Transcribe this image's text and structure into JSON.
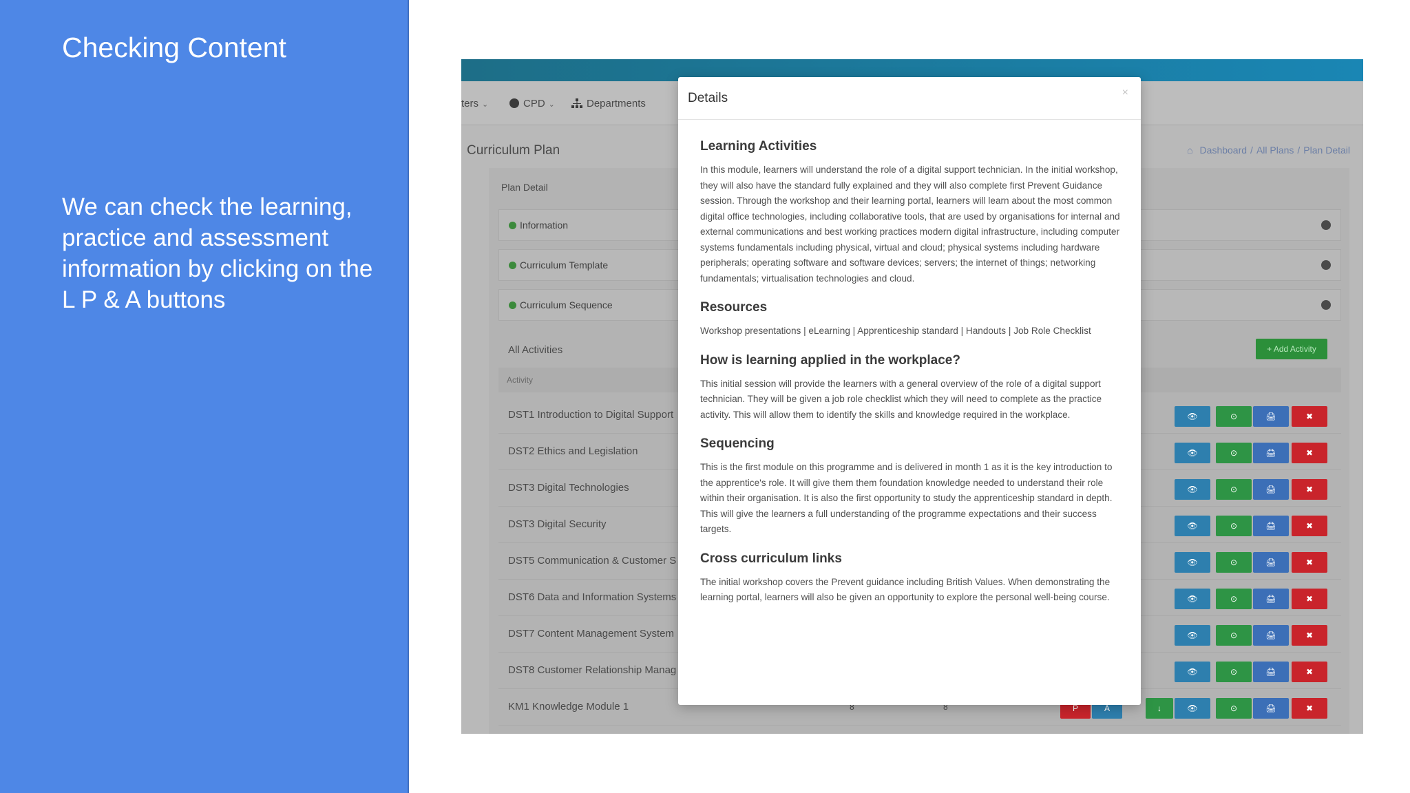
{
  "slide": {
    "title": "Checking Content",
    "body": "We can check the learning, practice and assessment information by clicking on the L P & A buttons"
  },
  "app": {
    "menu": [
      {
        "label": "ters",
        "icon": "none"
      },
      {
        "label": "CPD",
        "icon": "circle-icon"
      },
      {
        "label": "Departments",
        "icon": "sitemap-icon"
      }
    ],
    "page_heading": "Curriculum Plan",
    "breadcrumb": [
      "Dashboard",
      "All Plans",
      "Plan Detail"
    ],
    "card_title": "Plan Detail",
    "accordion": [
      "Information",
      "Curriculum Template",
      "Curriculum Sequence"
    ],
    "all_activities": "All Activities",
    "add_activity": "+ Add Activity",
    "table_header": "Activity",
    "activities": [
      "DST1 Introduction to Digital Support",
      "DST2 Ethics and Legislation",
      "DST3 Digital Technologies",
      "DST3 Digital Security",
      "DST5 Communication & Customer S",
      "DST6 Data and Information Systems",
      "DST7 Content Management System",
      "DST8 Customer Relationship Manag",
      "KM1 Knowledge Module 1"
    ],
    "last_row": {
      "col1": "8",
      "col2": "8",
      "p_label": "P",
      "a_label": "A",
      "dl_label": "↓"
    },
    "button_labels": {
      "view": "👁",
      "ok": "⊙",
      "print": "🖨",
      "del": "✖"
    }
  },
  "modal": {
    "title": "Details",
    "close": "×",
    "sections": [
      {
        "heading": "Learning Activities",
        "text": "In this module, learners will understand the role of a digital support technician. In the initial workshop, they will also have the standard fully explained and they will also complete first Prevent Guidance session. Through the workshop and their learning portal, learners will learn about the most common digital office technologies, including collaborative tools, that are used by organisations for internal and external communications and best working practices modern digital infrastructure, including computer systems fundamentals including physical, virtual and cloud; physical systems including hardware peripherals; operating software and software devices; servers; the internet of things; networking fundamentals; virtualisation technologies and cloud."
      },
      {
        "heading": "Resources",
        "text": "Workshop presentations | eLearning | Apprenticeship standard | Handouts | Job Role Checklist"
      },
      {
        "heading": "How is learning applied in the workplace?",
        "text": "This initial session will provide the learners with a general overview of the role of a digital support technician. They will be given a job role checklist which they will need to complete as the practice activity. This will allow them to identify the skills and knowledge required in the workplace."
      },
      {
        "heading": "Sequencing",
        "text": "This is the first module on this programme and is delivered in month 1 as it is the key introduction to the apprentice's role. It will give them them foundation knowledge needed to understand their role within their organisation. It is also the first opportunity to study the apprenticeship standard in depth. This will give the learners a full understanding of the programme expectations and their success targets."
      },
      {
        "heading": "Cross curriculum links",
        "text": "The initial workshop covers the Prevent guidance including British Values. When demonstrating the learning portal, learners will also be given an opportunity to explore the personal well-being course."
      }
    ]
  }
}
